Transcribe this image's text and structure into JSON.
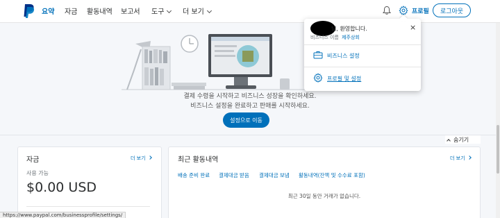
{
  "nav": {
    "items": [
      {
        "label": "요약",
        "active": true
      },
      {
        "label": "자금",
        "active": false
      },
      {
        "label": "활동내역",
        "active": false
      },
      {
        "label": "보고서",
        "active": false
      },
      {
        "label": "도구",
        "active": false,
        "dropdown": true
      },
      {
        "label": "더 보기",
        "active": false,
        "dropdown": true
      }
    ],
    "profile_label": "프로필",
    "logout_label": "로그아웃"
  },
  "hero": {
    "line1": "결제 수령을 시작하고 비즈니스 성장을 확인하세요.",
    "line2": "비즈니스 설정을 완료하고 판매를 시작하세요.",
    "button_label": "설정으로 이동"
  },
  "popup": {
    "welcome": "님, 환영합니다.",
    "business_name_label": "비즈니스 이름",
    "business_name_value": "제주상회",
    "close": "×",
    "link1": "비즈니스 설정",
    "link2": "프로필 및 설정"
  },
  "hide_label": "숨기기",
  "funds_card": {
    "title": "자금",
    "more": "더 보기",
    "available_label": "사용 가능",
    "balance": "$0.00 USD"
  },
  "activity_card": {
    "title": "최근 활동내역",
    "more": "더 보기",
    "tabs": [
      "배송 준비 완료",
      "결제대금 받음",
      "결제대금 보냄",
      "활동내역(잔액 및 수수료 포함)"
    ],
    "empty_message": "최근 30일 동안 거래가 없습니다."
  },
  "status_url": "https://www.paypal.com/businessprofile/settings/",
  "colors": {
    "accent": "#0070ba",
    "nav_bg": "#ffffff",
    "page_bg": "#f5f7fa"
  },
  "icons": [
    "paypal-logo",
    "bell-icon",
    "gear-icon",
    "briefcase-icon",
    "close-icon"
  ]
}
